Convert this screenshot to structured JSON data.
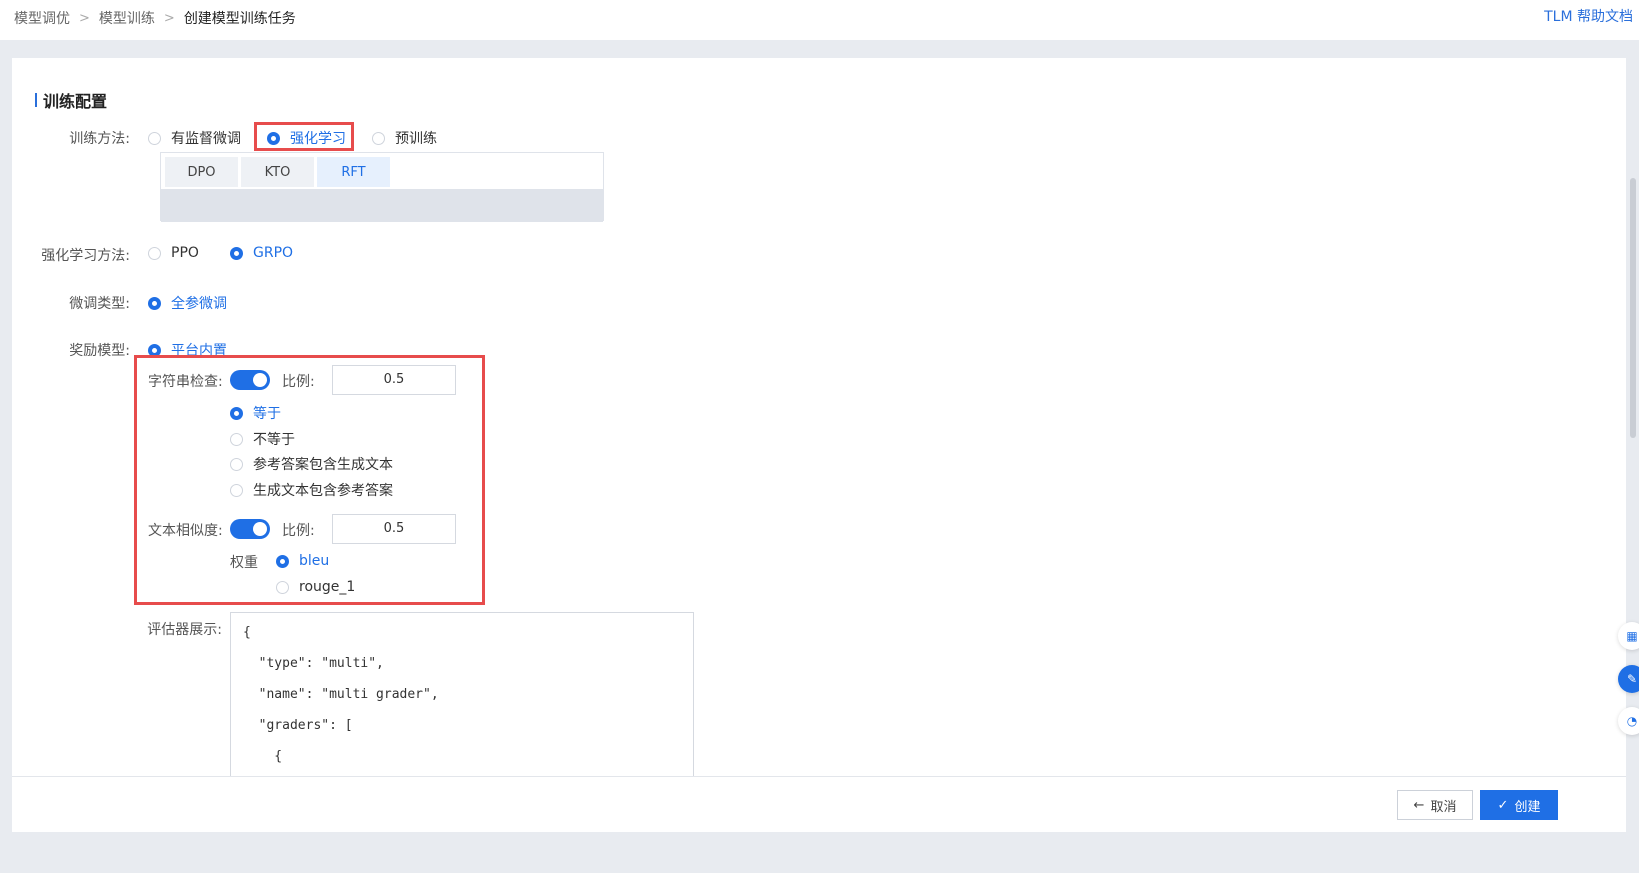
{
  "breadcrumb": [
    "模型调优",
    "模型训练",
    "创建模型训练任务"
  ],
  "help_link": "TLM 帮助文档",
  "section_title": "训练配置",
  "training_method": {
    "label": "训练方法:",
    "options": [
      "有监督微调",
      "强化学习",
      "预训练"
    ],
    "selected": "强化学习",
    "subtabs": [
      "DPO",
      "KTO",
      "RFT"
    ],
    "active_subtab": "RFT"
  },
  "rl_method": {
    "label": "强化学习方法:",
    "options": [
      "PPO",
      "GRPO"
    ],
    "selected": "GRPO"
  },
  "finetune_type": {
    "label": "微调类型:",
    "options": [
      "全参微调"
    ],
    "selected": "全参微调"
  },
  "reward_model": {
    "label": "奖励模型:",
    "options": [
      "平台内置"
    ],
    "selected": "平台内置"
  },
  "string_check": {
    "label": "字符串检查:",
    "enabled": true,
    "ratio_label": "比例:",
    "ratio_value": "0.5",
    "options": [
      "等于",
      "不等于",
      "参考答案包含生成文本",
      "生成文本包含参考答案"
    ],
    "selected": "等于"
  },
  "text_similarity": {
    "label": "文本相似度:",
    "enabled": true,
    "ratio_label": "比例:",
    "ratio_value": "0.5",
    "weight_label": "权重",
    "options": [
      "bleu",
      "rouge_1"
    ],
    "selected": "bleu"
  },
  "evaluator": {
    "label": "评估器展示:",
    "lines": [
      "{",
      "  \"type\": \"multi\",",
      "  \"name\": \"multi grader\",",
      "  \"graders\": [",
      "    {"
    ]
  },
  "footer": {
    "cancel_label": "取消",
    "create_label": "创建"
  },
  "colors": {
    "accent": "#1f6fe5",
    "highlight": "#e74c4c"
  }
}
